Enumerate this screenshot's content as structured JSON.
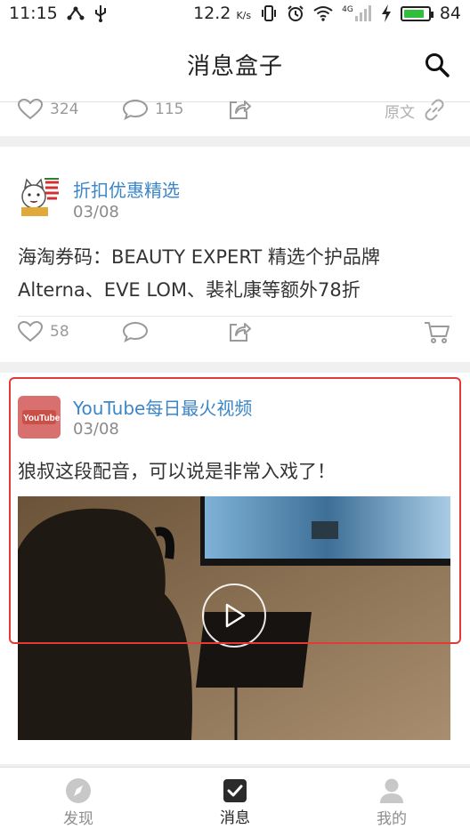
{
  "status_bar": {
    "time": "11:15",
    "speed": "12.2",
    "speed_unit": "K/s",
    "network": "4G",
    "battery": "84",
    "battery_level": 0.84
  },
  "header": {
    "title": "消息盒子"
  },
  "card1": {
    "likes": "324",
    "comments": "115",
    "original_label": "原文"
  },
  "card2": {
    "source": "折扣优惠精选",
    "date": "03/08",
    "text_line1": "海淘券码：BEAUTY EXPERT 精选个护品牌",
    "text_line2": "Alterna、EVE LOM、裴礼康等额外78折",
    "likes": "58"
  },
  "card3": {
    "source": "YouTube每日最火视频",
    "avatar_logo": "YouTube",
    "date": "03/08",
    "text": "狼叔这段配音，可以说是非常入戏了！"
  },
  "tabs": [
    {
      "label": "发现",
      "icon": "compass-icon",
      "active": false
    },
    {
      "label": "消息",
      "icon": "checkbox-icon",
      "active": true
    },
    {
      "label": "我的",
      "icon": "person-icon",
      "active": false
    }
  ]
}
